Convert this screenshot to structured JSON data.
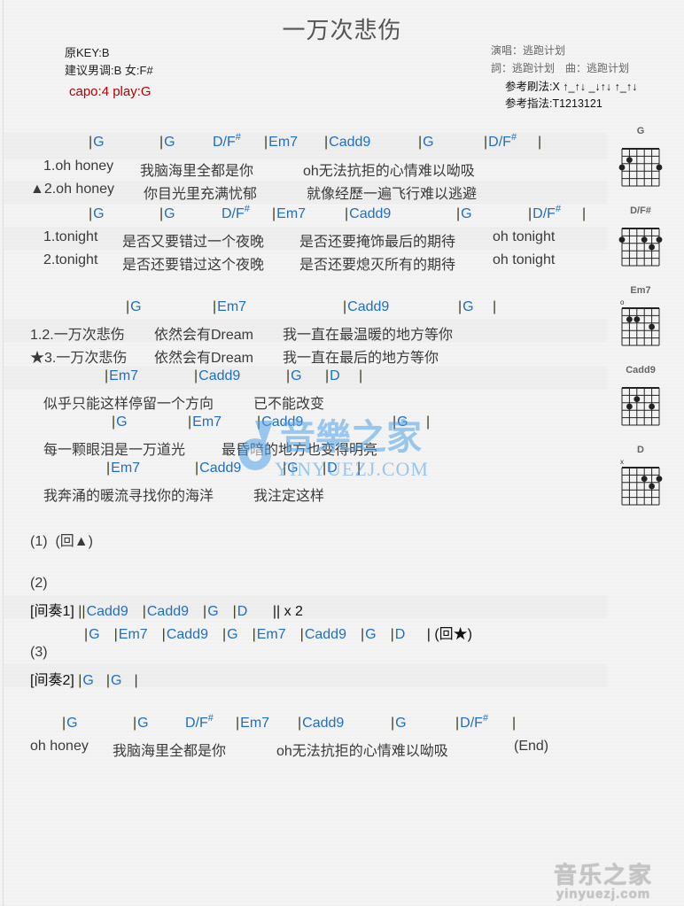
{
  "title": "一万次悲伤",
  "meta": {
    "original_key": "原KEY:B",
    "suggested_key": "建议男调:B 女:F#",
    "capo": "capo:4 play:G"
  },
  "credits": {
    "singer": "演唱：逃跑计划",
    "lyrics_music": "詞：逃跑计划　曲：逃跑计划",
    "strum": "参考刷法:X ↑_↑↓ _↓↑↓ ↑_↑↓",
    "fingerpick": "参考指法:T1213121"
  },
  "sections": [
    {
      "chords": [
        {
          "bar": "|",
          "name": "G"
        },
        {
          "bar": "|",
          "name": "G"
        },
        {
          "bar": "",
          "name": "D/F",
          "sharp": "#"
        },
        {
          "bar": "|",
          "name": "Em7"
        },
        {
          "bar": "|",
          "name": "Cadd9"
        },
        {
          "bar": "|",
          "name": "G"
        },
        {
          "bar": "|",
          "name": "D/F",
          "sharp": "#"
        },
        {
          "bar": "|",
          "name": ""
        }
      ],
      "lyrics": [
        [
          "1.oh honey",
          "我脑海里全都是你",
          "oh无法抗拒的心情难以呦吸"
        ],
        [
          "▲2.oh honey",
          "你目光里充满忧郁",
          "就像经歷一遍飞行难以逃避"
        ]
      ]
    },
    {
      "chords": [
        {
          "bar": "|",
          "name": "G"
        },
        {
          "bar": "|",
          "name": "G"
        },
        {
          "bar": "",
          "name": "D/F",
          "sharp": "#"
        },
        {
          "bar": "|",
          "name": "Em7"
        },
        {
          "bar": "|",
          "name": "Cadd9"
        },
        {
          "bar": "|",
          "name": "G"
        },
        {
          "bar": "|",
          "name": "D/F",
          "sharp": "#"
        },
        {
          "bar": "|",
          "name": ""
        }
      ],
      "lyrics": [
        [
          "1.tonight",
          "是否又要错过一个夜晚",
          "是否还要掩饰最后的期待",
          "oh tonight"
        ],
        [
          "2.tonight",
          "是否还要错过这个夜晚",
          "是否还要熄灭所有的期待",
          "oh tonight"
        ]
      ]
    },
    {
      "chords": [
        {
          "bar": "|",
          "name": "G"
        },
        {
          "bar": "|",
          "name": "Em7"
        },
        {
          "bar": "|",
          "name": "Cadd9"
        },
        {
          "bar": "|",
          "name": "G"
        },
        {
          "bar": "|",
          "name": ""
        }
      ],
      "lyrics": [
        [
          "1.2.一万次悲伤",
          "依然会有Dream",
          "我一直在最温暖的地方等你"
        ],
        [
          "★3.一万次悲伤",
          "依然会有Dream",
          "我一直在最后的地方等你"
        ]
      ]
    },
    {
      "chords": [
        {
          "bar": "|",
          "name": "Em7"
        },
        {
          "bar": "|",
          "name": "Cadd9"
        },
        {
          "bar": "|",
          "name": "G"
        },
        {
          "bar": "|",
          "name": "D"
        },
        {
          "bar": "|",
          "name": ""
        }
      ],
      "lyrics": [
        [
          "似乎只能这样停留一个方向",
          "已不能改变"
        ]
      ]
    },
    {
      "chords": [
        {
          "bar": "|",
          "name": "G"
        },
        {
          "bar": "|",
          "name": "Em7"
        },
        {
          "bar": "|",
          "name": "Cadd9"
        },
        {
          "bar": "|",
          "name": "G"
        },
        {
          "bar": "|",
          "name": ""
        }
      ],
      "lyrics": [
        [
          "每一颗眼泪是一万道光",
          "最昏暗的地方也变得明亮"
        ]
      ]
    },
    {
      "chords": [
        {
          "bar": "|",
          "name": "Em7"
        },
        {
          "bar": "|",
          "name": "Cadd9"
        },
        {
          "bar": "|",
          "name": "G"
        },
        {
          "bar": "|",
          "name": "D"
        },
        {
          "bar": "|",
          "name": ""
        }
      ],
      "lyrics": [
        [
          "我奔涌的暖流寻找你的海洋",
          "我注定这样"
        ]
      ]
    }
  ],
  "structure": {
    "part1": "(1)",
    "part1_return": "(回▲)",
    "part2": "(2)",
    "interlude1_label": "[间奏1]",
    "interlude1_open": "||",
    "interlude1_chords": [
      {
        "bar": "",
        "name": "Cadd9"
      },
      {
        "bar": "|",
        "name": "Cadd9"
      },
      {
        "bar": "|",
        "name": "G"
      },
      {
        "bar": "|",
        "name": "D"
      }
    ],
    "interlude1_repeat": "|| x 2",
    "line2_chords": [
      {
        "bar": "|",
        "name": "G"
      },
      {
        "bar": "|",
        "name": "Em7"
      },
      {
        "bar": "|",
        "name": "Cadd9"
      },
      {
        "bar": "|",
        "name": "G"
      },
      {
        "bar": "|",
        "name": "Em7"
      },
      {
        "bar": "|",
        "name": "Cadd9"
      },
      {
        "bar": "|",
        "name": "G"
      },
      {
        "bar": "|",
        "name": "D"
      }
    ],
    "line2_end": "| (回★)",
    "part3": "(3)",
    "interlude2_label": "[间奏2]",
    "interlude2_chords": [
      {
        "bar": "|",
        "name": "G"
      },
      {
        "bar": "|",
        "name": "G"
      },
      {
        "bar": "|",
        "name": ""
      }
    ]
  },
  "ending": {
    "chords": [
      {
        "bar": "|",
        "name": "G"
      },
      {
        "bar": "|",
        "name": "G"
      },
      {
        "bar": "",
        "name": "D/F",
        "sharp": "#"
      },
      {
        "bar": "|",
        "name": "Em7"
      },
      {
        "bar": "|",
        "name": "Cadd9"
      },
      {
        "bar": "|",
        "name": "G"
      },
      {
        "bar": "|",
        "name": "D/F",
        "sharp": "#"
      },
      {
        "bar": "|",
        "name": ""
      }
    ],
    "lyrics": [
      "oh honey",
      "我脑海里全都是你",
      "oh无法抗拒的心情难以呦吸",
      "(End)"
    ]
  },
  "chord_diagrams": [
    {
      "name": "G",
      "marker": "",
      "dots": [
        [
          2,
          2
        ],
        [
          3,
          1
        ],
        [
          3,
          6
        ]
      ]
    },
    {
      "name": "D/F#",
      "marker": "",
      "dots": [
        [
          2,
          1
        ],
        [
          2,
          4
        ],
        [
          3,
          5
        ],
        [
          2,
          6
        ]
      ]
    },
    {
      "name": "Em7",
      "marker": "o",
      "dots": [
        [
          2,
          2
        ],
        [
          2,
          3
        ],
        [
          3,
          5
        ]
      ]
    },
    {
      "name": "Cadd9",
      "marker": "",
      "dots": [
        [
          2,
          3
        ],
        [
          3,
          2
        ],
        [
          3,
          5
        ]
      ]
    },
    {
      "name": "D",
      "marker": "x",
      "dots": [
        [
          2,
          4
        ],
        [
          2,
          6
        ],
        [
          3,
          5
        ]
      ]
    }
  ],
  "watermark": {
    "text": "YINYUEZJ.COM",
    "logo": "音樂之家"
  },
  "footer_logo": {
    "big": "音乐之家",
    "small": "yinyuezj.com"
  },
  "colors": {
    "chord": "#1f6fbf",
    "capo": "#b40000",
    "bar": "#3b3a1e"
  }
}
